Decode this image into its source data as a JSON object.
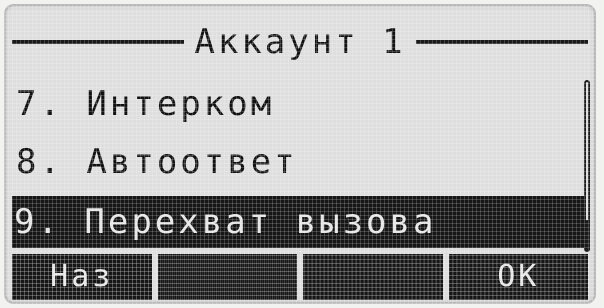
{
  "header": {
    "title": "Аккаунт 1"
  },
  "menu": {
    "items": [
      {
        "label": "7. Интерком",
        "selected": false
      },
      {
        "label": "8. Автоответ",
        "selected": false
      },
      {
        "label": "9. Перехват вызова",
        "selected": true
      }
    ]
  },
  "softkeys": [
    {
      "label": "Наз"
    },
    {
      "label": ""
    },
    {
      "label": ""
    },
    {
      "label": "ОК"
    }
  ],
  "colors": {
    "lcd_background": "#dedede",
    "ink": "#161616",
    "highlight_text": "#e6e6e6"
  }
}
